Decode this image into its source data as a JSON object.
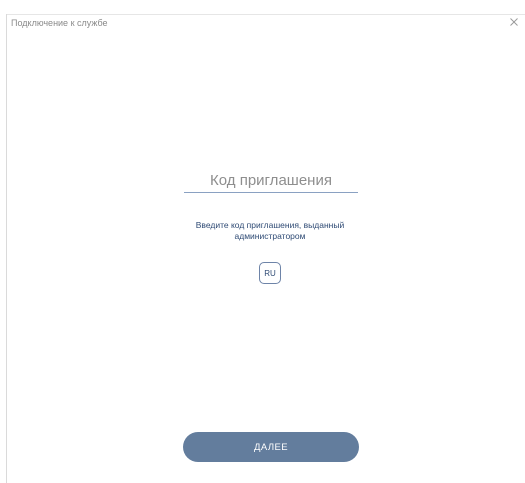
{
  "window": {
    "title": "Подключение к службе",
    "close_icon": "close-icon"
  },
  "form": {
    "invite_placeholder": "Код приглашения",
    "invite_value": "",
    "hint": "Введите код приглашения, выданный администратором",
    "language_label": "RU",
    "next_label": "ДАЛЕЕ"
  },
  "colors": {
    "accent": "#637d9d",
    "hint_text": "#2e4a74",
    "field_underline": "#8aa1c2"
  }
}
